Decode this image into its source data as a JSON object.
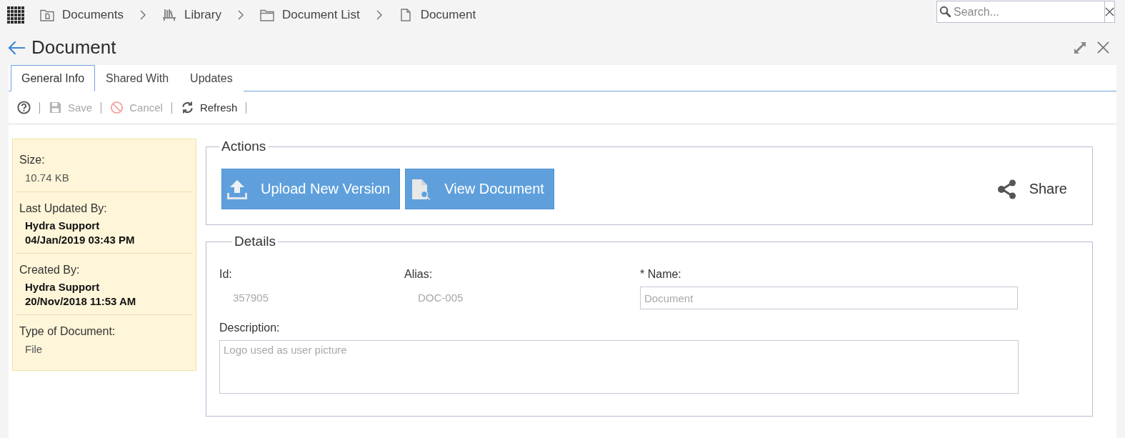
{
  "breadcrumb": [
    {
      "kind": "documents",
      "label": "Documents"
    },
    {
      "kind": "library",
      "label": "Library"
    },
    {
      "kind": "list",
      "label": "Document List"
    },
    {
      "kind": "document",
      "label": "Document"
    }
  ],
  "search": {
    "placeholder": "Search..."
  },
  "page": {
    "title": "Document"
  },
  "tabs": [
    {
      "label": "General Info",
      "selected": true
    },
    {
      "label": "Shared With",
      "selected": false
    },
    {
      "label": "Updates",
      "selected": false
    }
  ],
  "toolbar": [
    {
      "kind": "help",
      "disabled": false
    },
    {
      "kind": "save",
      "label": "Save",
      "disabled": true
    },
    {
      "kind": "cancel",
      "label": "Cancel",
      "disabled": true
    },
    {
      "kind": "refresh",
      "label": "Refresh",
      "disabled": false
    }
  ],
  "info_panel": [
    {
      "kind": "plain",
      "label": "Size:",
      "values": [
        "10.74 KB"
      ]
    },
    {
      "kind": "person",
      "label": "Last Updated By:",
      "values": [
        "Hydra Support",
        "04/Jan/2019 03:43 PM"
      ]
    },
    {
      "kind": "person",
      "label": "Created By:",
      "values": [
        "Hydra Support",
        "20/Nov/2018 11:53 AM"
      ]
    },
    {
      "kind": "plain",
      "label": "Type of Document:",
      "values": [
        "File"
      ]
    }
  ],
  "actions": {
    "legend": "Actions",
    "buttons": [
      {
        "kind": "upload",
        "label": "Upload New Version"
      },
      {
        "kind": "view",
        "label": "View Document"
      }
    ],
    "share": {
      "label": "Share"
    }
  },
  "details": {
    "legend": "Details",
    "fields": [
      {
        "kind": "text",
        "label": "Id:",
        "value": "357905"
      },
      {
        "kind": "text",
        "label": "Alias:",
        "value": "DOC-005"
      },
      {
        "kind": "input",
        "label": "* Name:",
        "value": "Document",
        "disabled": true
      }
    ],
    "description": {
      "label": "Description:",
      "value": "Logo used as user picture",
      "disabled": true
    }
  }
}
